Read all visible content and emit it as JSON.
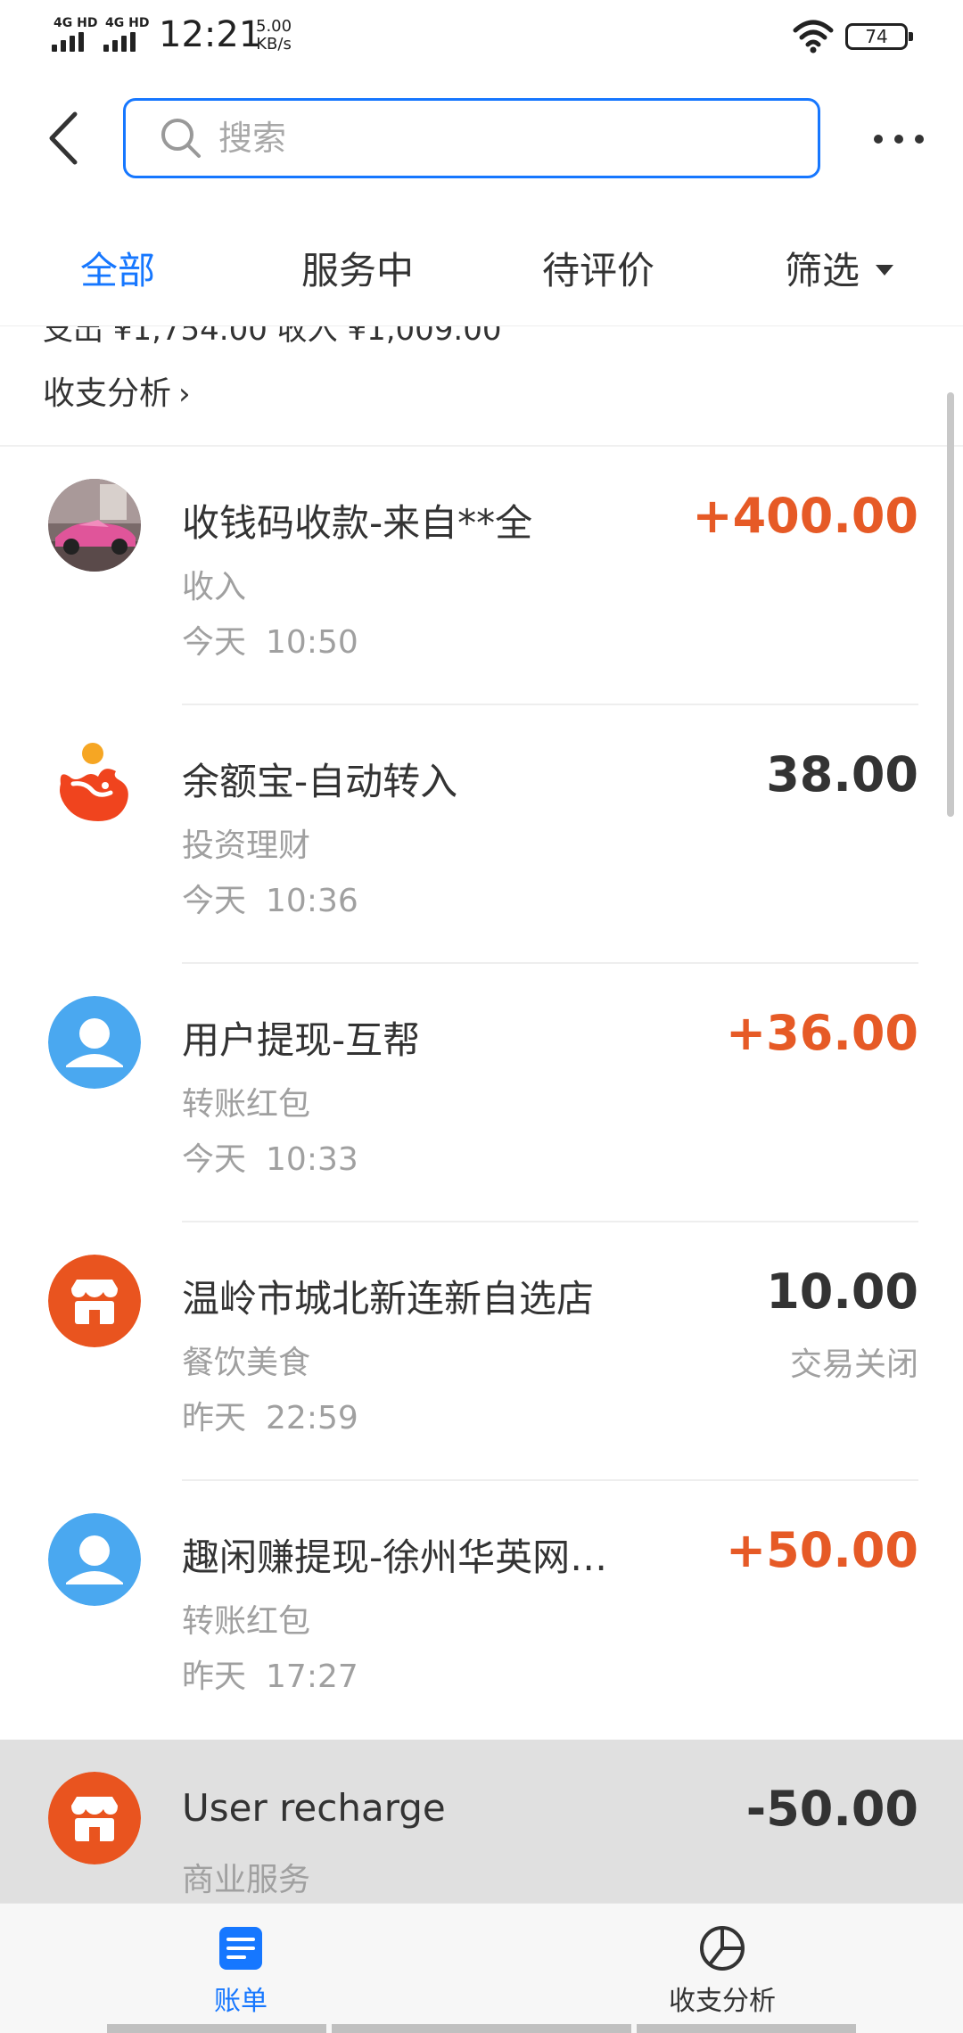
{
  "status_bar": {
    "sim1_label": "4G HD",
    "sim2_label": "4G HD",
    "time": "12:21",
    "net_speed_value": "5.00",
    "net_speed_unit": "KB/s",
    "battery_level": "74"
  },
  "header": {
    "search_placeholder": "搜索"
  },
  "tabs": [
    {
      "label": "全部",
      "active": true
    },
    {
      "label": "服务中",
      "active": false
    },
    {
      "label": "待评价",
      "active": false
    },
    {
      "label": "筛选",
      "active": false
    }
  ],
  "summary": {
    "partial_text": "支出 ¥1,754.00   收入 ¥1,009.00",
    "analysis_label": "收支分析",
    "analysis_chevron": "›"
  },
  "transactions": [
    {
      "title": "收钱码收款-来自**全",
      "category": "收入",
      "day": "今天",
      "time": "10:50",
      "amount": "+400.00",
      "status": "",
      "avatar": "photo-avatar",
      "income": true
    },
    {
      "title": "余额宝-自动转入",
      "category": "投资理财",
      "day": "今天",
      "time": "10:36",
      "amount": "38.00",
      "status": "",
      "avatar": "yuebao-icon",
      "income": false
    },
    {
      "title": "用户提现-互帮",
      "category": "转账红包",
      "day": "今天",
      "time": "10:33",
      "amount": "+36.00",
      "status": "",
      "avatar": "user-icon",
      "income": true
    },
    {
      "title": "温岭市城北新连新自选店",
      "category": "餐饮美食",
      "day": "昨天",
      "time": "22:59",
      "amount": "10.00",
      "status": "交易关闭",
      "avatar": "store-icon",
      "income": false
    },
    {
      "title": "趣闲赚提现-徐州华英网…",
      "category": "转账红包",
      "day": "昨天",
      "time": "17:27",
      "amount": "+50.00",
      "status": "",
      "avatar": "user-icon",
      "income": true
    },
    {
      "title": "User recharge",
      "category": "商业服务",
      "day": "",
      "time": "",
      "amount": "-50.00",
      "status": "",
      "avatar": "store-icon",
      "income": false
    }
  ],
  "bottom_nav": [
    {
      "label": "账单",
      "icon": "bill-icon",
      "active": true
    },
    {
      "label": "收支分析",
      "icon": "pie-chart-icon",
      "active": false
    }
  ],
  "colors": {
    "accent": "#1677ff",
    "income": "#e65a26",
    "store_orange": "#e9541f",
    "user_blue": "#4aa8f0"
  }
}
